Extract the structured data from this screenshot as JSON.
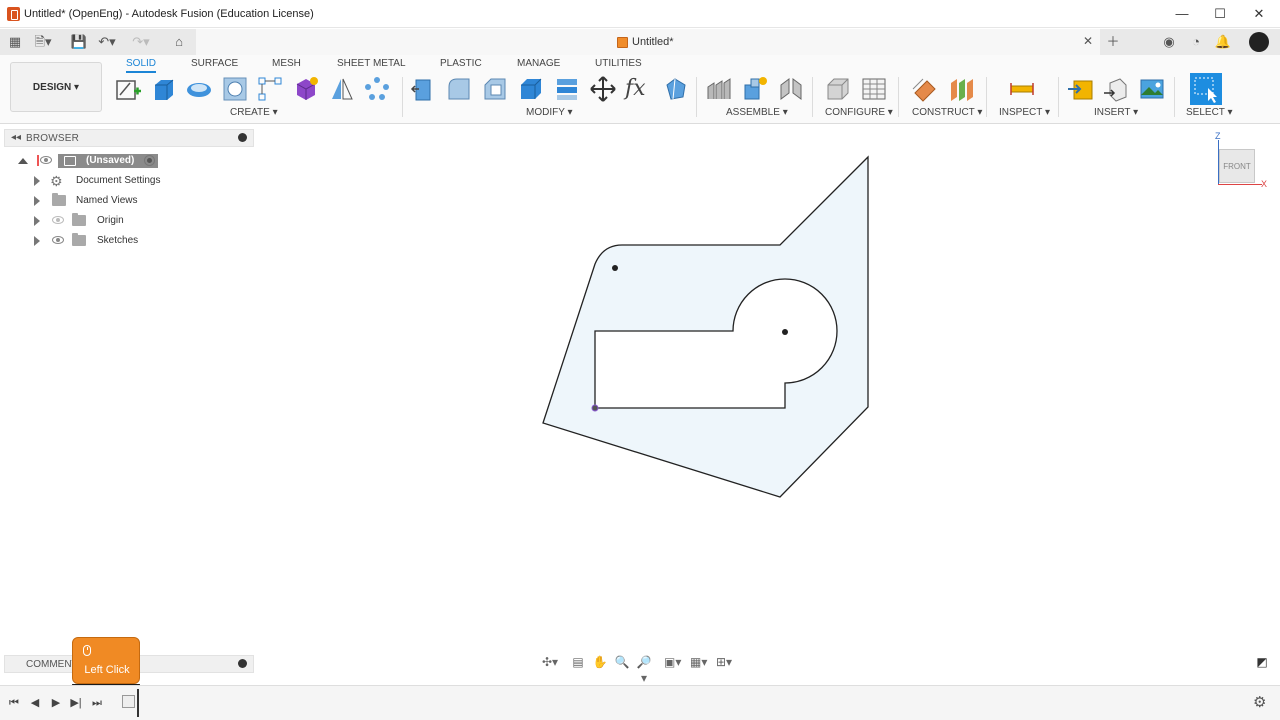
{
  "window": {
    "title": "Untitled* (OpenEng) - Autodesk Fusion (Education License)"
  },
  "document_tab": {
    "title": "Untitled*"
  },
  "toolbar": {
    "design_label": "DESIGN ▾",
    "workspace_tabs": [
      "SOLID",
      "SURFACE",
      "MESH",
      "SHEET METAL",
      "PLASTIC",
      "MANAGE",
      "UTILITIES"
    ],
    "active_tab": "SOLID",
    "groups": {
      "create": "CREATE ▾",
      "modify": "MODIFY ▾",
      "assemble": "ASSEMBLE ▾",
      "configure": "CONFIGURE ▾",
      "construct": "CONSTRUCT ▾",
      "inspect": "INSPECT ▾",
      "insert": "INSERT ▾",
      "select": "SELECT ▾"
    }
  },
  "browser": {
    "header": "BROWSER",
    "root": "(Unsaved)",
    "items": [
      {
        "label": "Document Settings"
      },
      {
        "label": "Named Views"
      },
      {
        "label": "Origin"
      },
      {
        "label": "Sketches"
      }
    ]
  },
  "viewcube": {
    "face": "FRONT",
    "axis_z": "Z",
    "axis_x": "X"
  },
  "comments": {
    "label": "COMMENTS"
  },
  "click_overlay": {
    "label": "Left Click"
  },
  "colors": {
    "accent": "#1c85d6",
    "sketch_fill": "#eef6fb",
    "click_overlay": "#f08a24"
  }
}
